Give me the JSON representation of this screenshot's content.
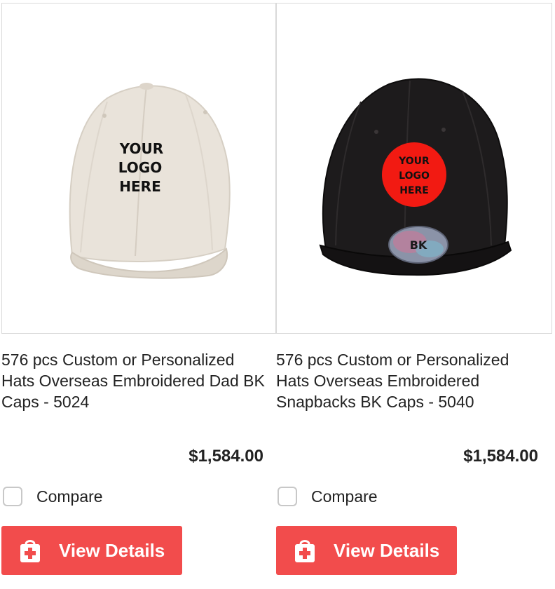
{
  "products": [
    {
      "title": "576 pcs Custom or Personalized Hats Overseas Embroidered Dad BK Caps - 5024",
      "logo_lines": [
        "YOUR",
        "LOGO",
        "HERE"
      ],
      "price": "$1,584.00",
      "compare_label": "Compare",
      "button_label": "View Details",
      "cap_color": "#e9e3da"
    },
    {
      "title": "576 pcs Custom or Personalized Hats Overseas Embroidered Snapbacks BK Caps - 5040",
      "logo_lines": [
        "YOUR",
        "LOGO",
        "HERE"
      ],
      "badge_text": "BK",
      "price": "$1,584.00",
      "compare_label": "Compare",
      "button_label": "View Details",
      "cap_color": "#1d1b1c",
      "logo_circle_color": "#f21a12"
    }
  ],
  "colors": {
    "button": "#f24c4c",
    "border": "#d9d9d9"
  }
}
